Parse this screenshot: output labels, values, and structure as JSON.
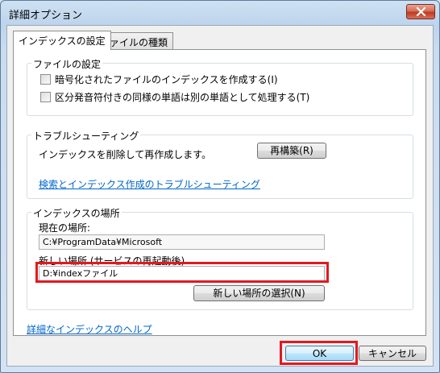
{
  "window": {
    "title": "詳細オプション"
  },
  "tabs": [
    {
      "label": "インデックスの設定",
      "active": true
    },
    {
      "label": "ファイルの種類",
      "active": false
    }
  ],
  "file_settings": {
    "legend": "ファイルの設定",
    "options": [
      {
        "label": "暗号化されたファイルのインデックスを作成する(I)",
        "checked": false
      },
      {
        "label": "区分発音符付きの同様の単語は別の単語として処理する(T)",
        "checked": false
      }
    ]
  },
  "troubleshoot": {
    "legend": "トラブルシューティング",
    "description": "インデックスを削除して再作成します。",
    "rebuild_label": "再構築(R)",
    "link": "検索とインデックス作成のトラブルシューティング"
  },
  "location": {
    "legend": "インデックスの場所",
    "current_label": "現在の場所:",
    "current_value": "C:¥ProgramData¥Microsoft",
    "new_label": "新しい場所 (サービスの再起動後)",
    "new_value": "D:¥indexファイル",
    "select_label": "新しい場所の選択(N)"
  },
  "help_link": "詳細なインデックスのヘルプ",
  "footer": {
    "ok_label": "OK",
    "cancel_label": "キャンセル"
  },
  "colors": {
    "highlight": "#e2191f",
    "link": "#0066cc",
    "close": "#c1391d"
  }
}
